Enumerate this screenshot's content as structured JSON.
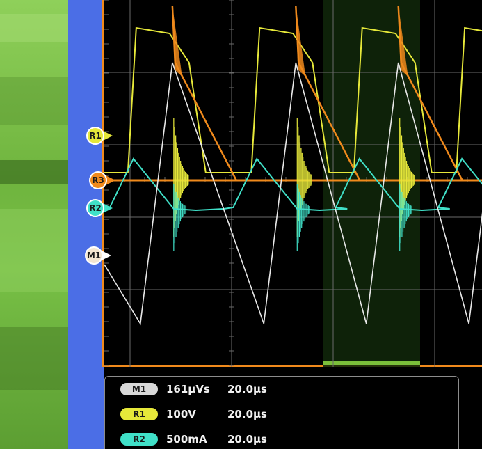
{
  "colors": {
    "background": "#000000",
    "frame": "#f08a1c",
    "grid": "#6a6a6a",
    "side_band": "#4b6ee6",
    "photo_green": "#78c046",
    "ch_r1": "#e6e83a",
    "ch_r2": "#40e0c8",
    "ch_r3": "#f08a1c",
    "ch_m1": "#e8e8e8"
  },
  "channel_markers": [
    {
      "id": "r1",
      "label": "R1",
      "color": "#e6e83a"
    },
    {
      "id": "r3",
      "label": "R3",
      "color": "#f08a1c"
    },
    {
      "id": "r2",
      "label": "R2",
      "color": "#40e0c8"
    },
    {
      "id": "m1",
      "label": "M1",
      "color": "#f4e6d0"
    }
  ],
  "readouts": [
    {
      "channel": "M1",
      "scale": "161μVs",
      "timebase": "20.0μs",
      "color": "#d8d8d8"
    },
    {
      "channel": "R1",
      "scale": "100V",
      "timebase": "20.0μs",
      "color": "#e6e83a"
    },
    {
      "channel": "R2",
      "scale": "500mA",
      "timebase": "20.0μs",
      "color": "#40e0c8"
    }
  ],
  "waveforms": {
    "cycle_starts": [
      0.07,
      0.395,
      0.665,
      0.935
    ],
    "period": 0.27
  }
}
